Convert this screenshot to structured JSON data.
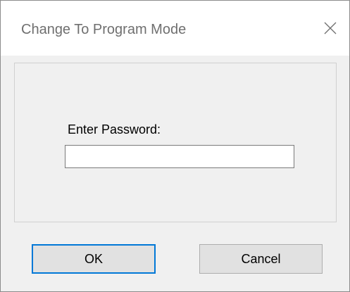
{
  "window": {
    "title": "Change To Program Mode",
    "close_icon": "close-icon"
  },
  "form": {
    "password_label": "Enter Password:",
    "password_value": "",
    "password_placeholder": ""
  },
  "buttons": {
    "ok_label": "OK",
    "cancel_label": "Cancel"
  },
  "colors": {
    "focus_border": "#0078d7",
    "button_face": "#e1e1e1",
    "dialog_background": "#f0f0f0"
  }
}
